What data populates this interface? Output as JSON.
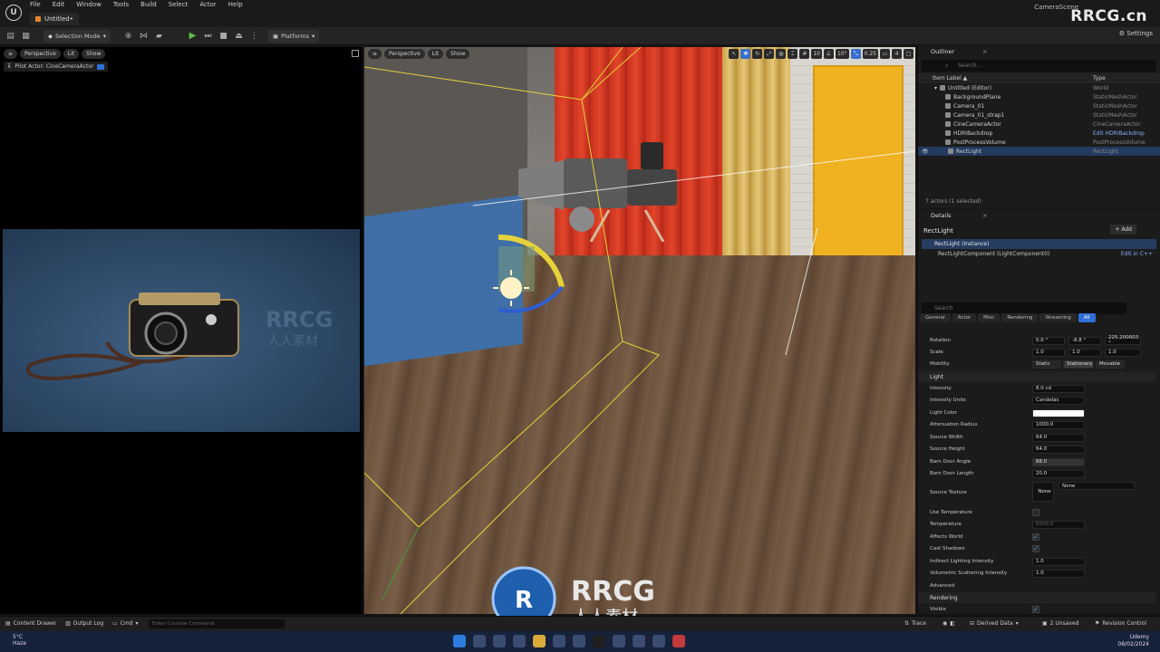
{
  "titlebar": {
    "menu": [
      "File",
      "Edit",
      "Window",
      "Tools",
      "Build",
      "Select",
      "Actor",
      "Help"
    ],
    "doc_tab": "Untitled•",
    "scene_name": "CameraScene",
    "watermark": "RRCG.cn"
  },
  "toolbar": {
    "selection_mode": "Selection Mode",
    "platforms": "Platforms",
    "settings": "Settings"
  },
  "left_viewport": {
    "menu_icon": "hamburger-icon",
    "perspective": "Perspective",
    "lit": "Lit",
    "show": "Show",
    "pilot": "Pilot Actor: CineCameraActor"
  },
  "main_viewport": {
    "perspective": "Perspective",
    "lit": "Lit",
    "show": "Show",
    "grid_snap": "10",
    "rot_snap": "10°",
    "scale_snap": "0.25",
    "cam_speed": "4"
  },
  "logo": {
    "big": "RRCG",
    "sub": "人人素材"
  },
  "outliner": {
    "tab": "Outliner",
    "search_placeholder": "Search...",
    "col_label": "Item Label ▲",
    "col_type": "Type",
    "rows": [
      {
        "label": "Untitled (Editor)",
        "type": "World"
      },
      {
        "label": "BackgroundPlane",
        "type": "StaticMeshActor"
      },
      {
        "label": "Camera_01",
        "type": "StaticMeshActor"
      },
      {
        "label": "Camera_01_strap1",
        "type": "StaticMeshActor"
      },
      {
        "label": "CineCameraActor",
        "type": "CineCameraActor"
      },
      {
        "label": "HDRIBackdrop",
        "type": "Edit HDRIBackdrop"
      },
      {
        "label": "PostProcessVolume",
        "type": "PostProcessVolume"
      },
      {
        "label": "RectLight",
        "type": "RectLight"
      }
    ],
    "count": "7 actors (1 selected)"
  },
  "details": {
    "tab": "Details",
    "actor_name": "RectLight",
    "add": "+ Add",
    "instance": "RectLight (Instance)",
    "component": "RectLightComponent (LightComponent0)",
    "edit_cpp": "Edit in C++",
    "search_placeholder": "Search",
    "filters": [
      "General",
      "Actor",
      "Misc",
      "Rendering",
      "Streaming",
      "All"
    ],
    "rotation": {
      "label": "Rotation",
      "x": "0.0 °",
      "y": "-8.8 °",
      "z": "225.200003 °"
    },
    "scale": {
      "label": "Scale",
      "x": "1.0",
      "y": "1.0",
      "z": "1.0"
    },
    "mobility": {
      "label": "Mobility",
      "opts": [
        "Static",
        "Stationary",
        "Movable"
      ]
    },
    "light_section": "Light",
    "intensity": {
      "label": "Intensity",
      "value": "8.0 cd"
    },
    "intensity_units": {
      "label": "Intensity Units",
      "value": "Candelas"
    },
    "light_color": {
      "label": "Light Color",
      "color": "#ffffff"
    },
    "attenuation": {
      "label": "Attenuation Radius",
      "value": "1000.0"
    },
    "source_width": {
      "label": "Source Width",
      "value": "64.0"
    },
    "source_height": {
      "label": "Source Height",
      "value": "64.0"
    },
    "barn_angle": {
      "label": "Barn Door Angle",
      "value": "88.0"
    },
    "barn_length": {
      "label": "Barn Door Length",
      "value": "20.0"
    },
    "source_texture": {
      "label": "Source Texture",
      "thumb": "None",
      "value": "None"
    },
    "use_temperature": "Use Temperature",
    "temperature": {
      "label": "Temperature",
      "value": "6500.0"
    },
    "affects_world": "Affects World",
    "cast_shadows": "Cast Shadows",
    "indirect": {
      "label": "Indirect Lighting Intensity",
      "value": "1.0"
    },
    "volumetric": {
      "label": "Volumetric Scattering Intensity",
      "value": "1.0"
    },
    "advanced": "Advanced",
    "rendering_section": "Rendering",
    "visible": "Visible"
  },
  "statusbar": {
    "content_drawer": "Content Drawer",
    "output_log": "Output Log",
    "cmd": "Cmd",
    "console_placeholder": "Enter Console Command",
    "trace": "Trace",
    "derived": "Derived Data",
    "unsaved": "2 Unsaved",
    "revision": "Revision Control"
  },
  "taskbar": {
    "temp": "5°C",
    "weather": "Haze",
    "time": "Udemy",
    "date": "08/02/2024"
  }
}
